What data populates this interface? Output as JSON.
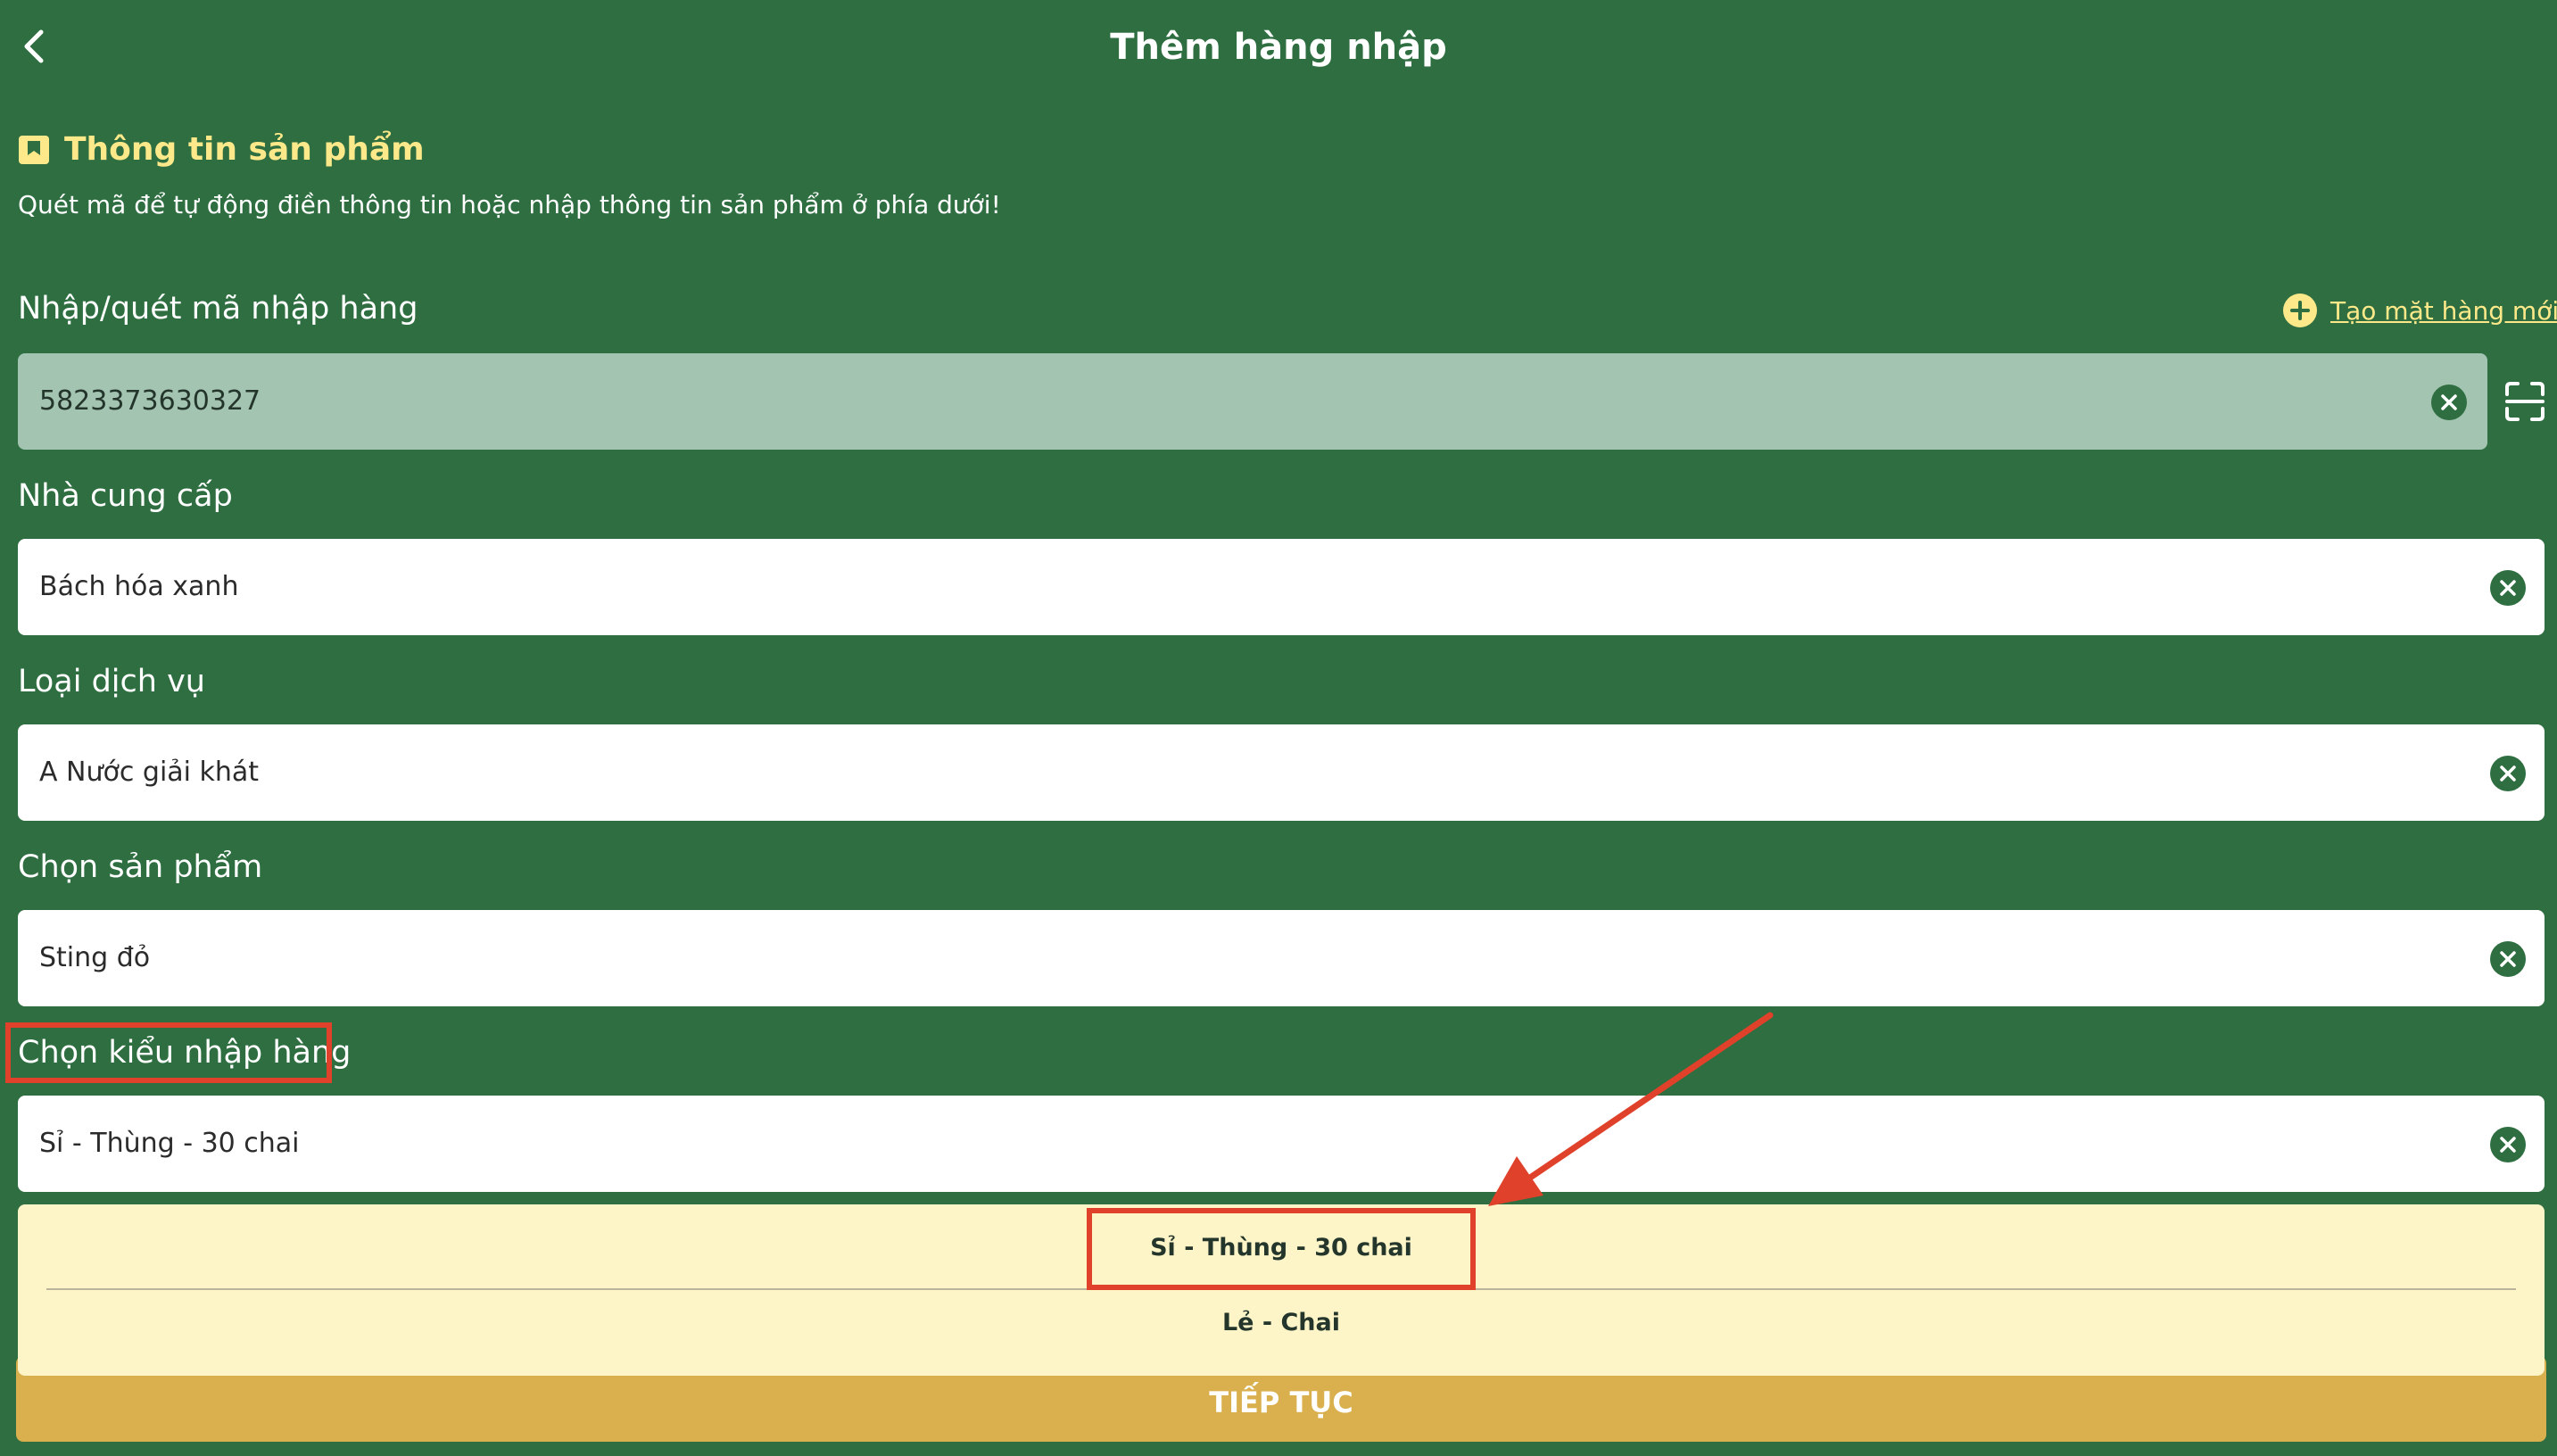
{
  "header": {
    "title": "Thêm hàng nhập",
    "back_icon": "chevron-left-icon"
  },
  "section": {
    "title": "Thông tin sản phẩm",
    "icon": "bookmark-icon",
    "description": "Quét mã để tự động điền thông tin hoặc nhập thông tin sản phẩm ở phía dưới!"
  },
  "form": {
    "code": {
      "label": "Nhập/quét mã nhập hàng",
      "value": "5823373630327",
      "create_new_label": "Tạo mặt hàng mới"
    },
    "supplier": {
      "label": "Nhà cung cấp",
      "value": "Bách hóa xanh"
    },
    "service_type": {
      "label": "Loại dịch vụ",
      "value": "A Nước giải khát"
    },
    "product": {
      "label": "Chọn sản phẩm",
      "value": "Sting đỏ"
    },
    "import_type": {
      "label": "Chọn kiểu nhập hàng",
      "value": "Sỉ - Thùng - 30 chai"
    }
  },
  "dropdown": {
    "options": [
      "Sỉ - Thùng - 30 chai",
      "Lẻ - Chai"
    ]
  },
  "continue_button": {
    "label": "TIẾP TỤC"
  },
  "colors": {
    "background": "#2e6e40",
    "accent_yellow": "#fde98a",
    "dropdown_bg": "#fdf5c8",
    "button": "#d9b04d",
    "highlight": "#e0412b"
  }
}
